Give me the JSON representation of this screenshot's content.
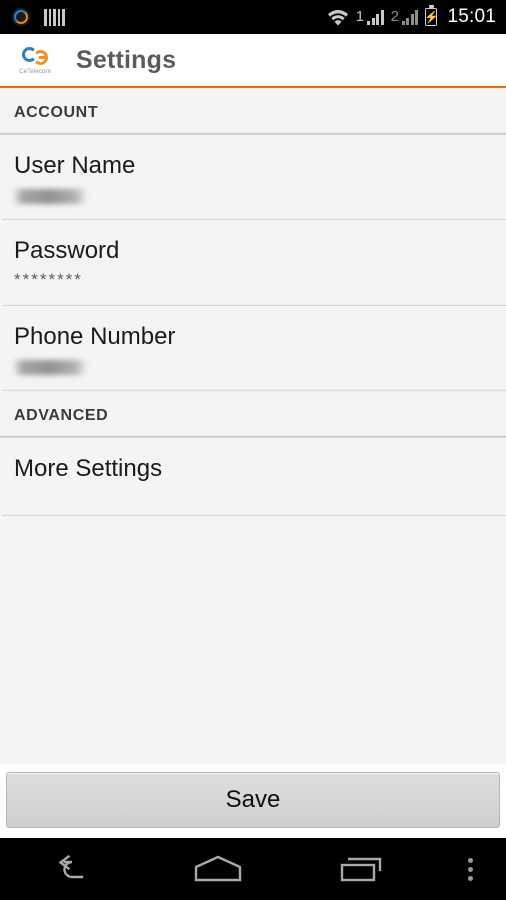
{
  "status_bar": {
    "notification_icons": [
      "cetelecom-app-icon",
      "barcode-icon"
    ],
    "wifi_icon": "wifi-icon",
    "sim1_label": "1",
    "sim1_icon": "signal-bars-icon",
    "sim2_label": "2",
    "sim2_icon": "signal-bars-icon",
    "battery_icon": "battery-charging-icon",
    "clock": "15:01"
  },
  "app_bar": {
    "logo_name": "cetelecom-logo",
    "logo_text": "CeTelecom",
    "title": "Settings",
    "accent_color": "#e8670c"
  },
  "sections": [
    {
      "header": "ACCOUNT",
      "items": [
        {
          "title": "User Name",
          "value": "",
          "value_redacted": true
        },
        {
          "title": "Password",
          "value": "********",
          "value_redacted": false
        },
        {
          "title": "Phone Number",
          "value": "",
          "value_redacted": true
        }
      ]
    },
    {
      "header": "ADVANCED",
      "items": [
        {
          "title": "More Settings",
          "value": "",
          "value_redacted": false
        }
      ]
    }
  ],
  "footer": {
    "save_label": "Save"
  },
  "nav_bar": {
    "back": "back-icon",
    "home": "home-icon",
    "recents": "recents-icon",
    "overflow": "overflow-menu-icon"
  }
}
